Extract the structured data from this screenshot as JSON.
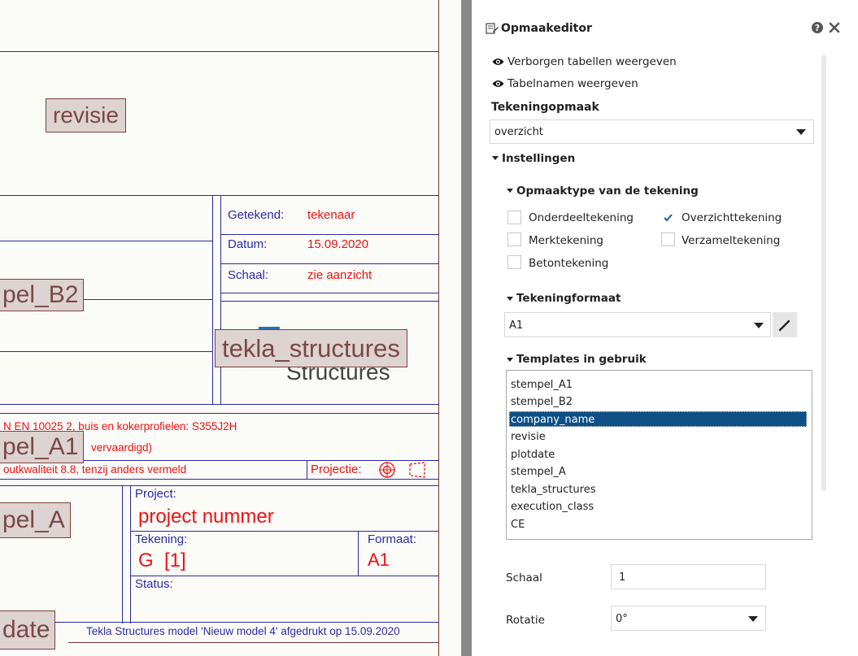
{
  "drawing": {
    "tags": {
      "revisie": "revisie",
      "stempel_b2": "pel_B2",
      "tekla_structures": "tekla_structures",
      "stempel_a1": "pel_A1",
      "stempel_a": "pel_A",
      "plotdate": "date"
    },
    "getekend_label": "Getekend:",
    "getekend_value": "tekenaar",
    "datum_label": "Datum:",
    "datum_value": "15.09.2020",
    "schaal_label": "Schaal:",
    "schaal_value": "zie aanzicht",
    "logo_text": "Structures",
    "material_line": "N EN 10025 2, buis en kokerprofielen: S355J2H",
    "manufactured_line": "vervaardigd)",
    "bolt_line": "outkwaliteit 8.8, tenzij anders vermeld",
    "projectie_label": "Projectie:",
    "project_label": "Project:",
    "project_value": "project nummer",
    "tekening_label": "Tekening:",
    "tekening_value": "G  [1]",
    "formaat_label": "Formaat:",
    "formaat_value": "A1",
    "status_label": "Status:",
    "footer_text": "Tekla Structures model 'Nieuw model 4' afgedrukt op 15.09.2020"
  },
  "panel": {
    "title": "Opmaakeditor",
    "show_hidden_tables": "Verborgen tabellen weergeven",
    "show_table_names": "Tabelnamen weergeven",
    "drawing_layout_label": "Tekeningopmaak",
    "drawing_layout_value": "overzicht",
    "settings_label": "Instellingen",
    "layout_type_label": "Opmaaktype van de tekening",
    "checkboxes": {
      "onderdeel": {
        "label": "Onderdeeltekening",
        "checked": false
      },
      "overzicht": {
        "label": "Overzichttekening",
        "checked": true
      },
      "merk": {
        "label": "Merktekening",
        "checked": false
      },
      "verzamel": {
        "label": "Verzameltekening",
        "checked": false
      },
      "beton": {
        "label": "Betontekening",
        "checked": false
      }
    },
    "format_label": "Tekeningformaat",
    "format_value": "A1",
    "templates_label": "Templates in gebruik",
    "templates": [
      "stempel_A1",
      "stempel_B2",
      "company_name",
      "revisie",
      "plotdate",
      "stempel_A",
      "tekla_structures",
      "execution_class",
      "CE"
    ],
    "selected_template": "company_name",
    "scale_label": "Schaal",
    "scale_value": "1",
    "rotation_label": "Rotatie",
    "rotation_value": "0°",
    "colors": {
      "selection": "#0e4f86",
      "check": "#1a5fa8",
      "drawing_text_red": "#ee1111",
      "drawing_text_blue": "#2b2ba8"
    }
  }
}
